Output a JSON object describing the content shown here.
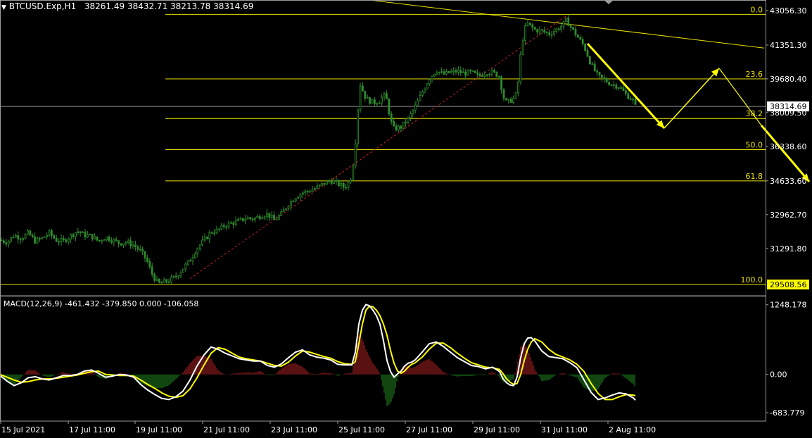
{
  "header": {
    "symbol": "BTCUSD.Exp,H1",
    "ohlc": "38261.49 38432.71 38213.78 38314.69"
  },
  "macd": {
    "label": "MACD(12,26,9) -461.432 -379.850 0.000 -106.058",
    "ticks": [
      "1248.178",
      "0.00",
      "-683.779"
    ]
  },
  "colors": {
    "background": "#000000",
    "bull": "#2E8B2E",
    "bear": "#2E8B2E",
    "fib": "#E8E000",
    "arrow": "#FFFF00",
    "macd_line": "#FFFFFF",
    "signal_line": "#FFFF00",
    "hist_pos": "#B22222",
    "hist_neg": "#228B22"
  },
  "chart_data": {
    "type": "candlestick",
    "symbol": "BTCUSD.Exp",
    "timeframe": "H1",
    "y_ticks": [
      "43056.30",
      "41351.30",
      "39680.40",
      "38009.50",
      "36338.60",
      "34633.60",
      "32962.70",
      "31291.80"
    ],
    "price_labels": {
      "current": "38314.69",
      "low": "29508.56"
    },
    "ylim": [
      29300,
      43300
    ],
    "x_ticks": [
      "15 Jul 2021",
      "17 Jul 11:00",
      "19 Jul 11:00",
      "21 Jul 11:00",
      "23 Jul 11:00",
      "25 Jul 11:00",
      "27 Jul 11:00",
      "29 Jul 11:00",
      "31 Jul 11:00",
      "2 Aug 11:00"
    ],
    "fib_levels": [
      {
        "label": "0.0",
        "price": 42870
      },
      {
        "label": "23.6",
        "price": 39680
      },
      {
        "label": "38.2",
        "price": 37720
      },
      {
        "label": "50.0",
        "price": 36180
      },
      {
        "label": "61.8",
        "price": 34633
      },
      {
        "label": "100.0",
        "price": 29508
      }
    ],
    "price_path": [
      [
        0,
        31700
      ],
      [
        10,
        31600
      ],
      [
        20,
        31950
      ],
      [
        30,
        31800
      ],
      [
        40,
        32050
      ],
      [
        50,
        31650
      ],
      [
        60,
        31800
      ],
      [
        70,
        32050
      ],
      [
        80,
        31700
      ],
      [
        90,
        31650
      ],
      [
        100,
        31900
      ],
      [
        110,
        32150
      ],
      [
        120,
        31950
      ],
      [
        130,
        31900
      ],
      [
        140,
        31650
      ],
      [
        150,
        31850
      ],
      [
        160,
        31700
      ],
      [
        170,
        31550
      ],
      [
        180,
        31600
      ],
      [
        190,
        31450
      ],
      [
        200,
        31150
      ],
      [
        205,
        30900
      ],
      [
        210,
        30600
      ],
      [
        215,
        30100
      ],
      [
        220,
        29800
      ],
      [
        225,
        29550
      ],
      [
        230,
        29600
      ],
      [
        240,
        29700
      ],
      [
        250,
        29900
      ],
      [
        260,
        30300
      ],
      [
        270,
        30700
      ],
      [
        280,
        31300
      ],
      [
        290,
        31700
      ],
      [
        300,
        32100
      ],
      [
        310,
        32200
      ],
      [
        320,
        32450
      ],
      [
        330,
        32550
      ],
      [
        340,
        32650
      ],
      [
        350,
        32800
      ],
      [
        360,
        32750
      ],
      [
        370,
        32900
      ],
      [
        380,
        33000
      ],
      [
        390,
        32700
      ],
      [
        400,
        33000
      ],
      [
        410,
        33500
      ],
      [
        420,
        33850
      ],
      [
        430,
        34050
      ],
      [
        440,
        34150
      ],
      [
        450,
        34300
      ],
      [
        460,
        34500
      ],
      [
        470,
        34650
      ],
      [
        480,
        34500
      ],
      [
        490,
        34300
      ],
      [
        495,
        34550
      ],
      [
        500,
        34900
      ],
      [
        505,
        36500
      ],
      [
        508,
        38000
      ],
      [
        512,
        39400
      ],
      [
        520,
        38700
      ],
      [
        530,
        38500
      ],
      [
        540,
        38600
      ],
      [
        545,
        38900
      ],
      [
        550,
        38600
      ],
      [
        555,
        37600
      ],
      [
        560,
        37200
      ],
      [
        570,
        37300
      ],
      [
        580,
        37700
      ],
      [
        590,
        38300
      ],
      [
        600,
        39000
      ],
      [
        610,
        39700
      ],
      [
        620,
        40100
      ],
      [
        630,
        39900
      ],
      [
        640,
        40000
      ],
      [
        650,
        40050
      ],
      [
        660,
        39950
      ],
      [
        670,
        40000
      ],
      [
        680,
        39800
      ],
      [
        690,
        40000
      ],
      [
        700,
        40000
      ],
      [
        710,
        39800
      ],
      [
        715,
        38800
      ],
      [
        720,
        38500
      ],
      [
        730,
        38700
      ],
      [
        735,
        39000
      ],
      [
        740,
        40900
      ],
      [
        745,
        42100
      ],
      [
        750,
        42400
      ],
      [
        760,
        42100
      ],
      [
        770,
        42050
      ],
      [
        780,
        41900
      ],
      [
        790,
        42100
      ],
      [
        800,
        42350
      ],
      [
        805,
        42600
      ],
      [
        810,
        42300
      ],
      [
        820,
        41800
      ],
      [
        830,
        41300
      ],
      [
        840,
        40400
      ],
      [
        850,
        39800
      ],
      [
        860,
        39600
      ],
      [
        870,
        39400
      ],
      [
        880,
        39300
      ],
      [
        890,
        38900
      ],
      [
        900,
        38600
      ],
      [
        903,
        38314
      ]
    ],
    "macd_line": [
      [
        0,
        -20
      ],
      [
        10,
        -120
      ],
      [
        20,
        -200
      ],
      [
        30,
        -150
      ],
      [
        40,
        -60
      ],
      [
        50,
        -40
      ],
      [
        60,
        -80
      ],
      [
        70,
        -100
      ],
      [
        80,
        -60
      ],
      [
        90,
        -20
      ],
      [
        100,
        -20
      ],
      [
        110,
        0
      ],
      [
        120,
        60
      ],
      [
        130,
        80
      ],
      [
        140,
        20
      ],
      [
        150,
        -50
      ],
      [
        160,
        -30
      ],
      [
        170,
        0
      ],
      [
        180,
        -10
      ],
      [
        190,
        -50
      ],
      [
        200,
        -180
      ],
      [
        210,
        -280
      ],
      [
        220,
        -360
      ],
      [
        230,
        -430
      ],
      [
        240,
        -450
      ],
      [
        250,
        -400
      ],
      [
        260,
        -300
      ],
      [
        270,
        -100
      ],
      [
        280,
        150
      ],
      [
        290,
        350
      ],
      [
        300,
        490
      ],
      [
        310,
        450
      ],
      [
        320,
        380
      ],
      [
        330,
        330
      ],
      [
        340,
        280
      ],
      [
        350,
        260
      ],
      [
        360,
        240
      ],
      [
        370,
        240
      ],
      [
        380,
        160
      ],
      [
        390,
        130
      ],
      [
        400,
        190
      ],
      [
        410,
        300
      ],
      [
        420,
        400
      ],
      [
        430,
        440
      ],
      [
        440,
        350
      ],
      [
        450,
        310
      ],
      [
        460,
        290
      ],
      [
        470,
        260
      ],
      [
        480,
        180
      ],
      [
        490,
        170
      ],
      [
        500,
        170
      ],
      [
        505,
        400
      ],
      [
        510,
        900
      ],
      [
        515,
        1150
      ],
      [
        520,
        1250
      ],
      [
        525,
        1230
      ],
      [
        530,
        1150
      ],
      [
        535,
        1050
      ],
      [
        540,
        900
      ],
      [
        545,
        600
      ],
      [
        550,
        250
      ],
      [
        555,
        50
      ],
      [
        560,
        -50
      ],
      [
        565,
        10
      ],
      [
        570,
        60
      ],
      [
        575,
        150
      ],
      [
        580,
        200
      ],
      [
        585,
        220
      ],
      [
        590,
        260
      ],
      [
        600,
        400
      ],
      [
        610,
        550
      ],
      [
        620,
        580
      ],
      [
        630,
        500
      ],
      [
        640,
        400
      ],
      [
        650,
        300
      ],
      [
        660,
        230
      ],
      [
        670,
        160
      ],
      [
        680,
        140
      ],
      [
        690,
        100
      ],
      [
        700,
        130
      ],
      [
        710,
        50
      ],
      [
        715,
        -80
      ],
      [
        720,
        -150
      ],
      [
        725,
        -190
      ],
      [
        730,
        -200
      ],
      [
        735,
        -40
      ],
      [
        740,
        300
      ],
      [
        745,
        550
      ],
      [
        750,
        650
      ],
      [
        755,
        660
      ],
      [
        760,
        600
      ],
      [
        770,
        420
      ],
      [
        780,
        320
      ],
      [
        790,
        300
      ],
      [
        800,
        280
      ],
      [
        810,
        210
      ],
      [
        820,
        120
      ],
      [
        830,
        -100
      ],
      [
        840,
        -320
      ],
      [
        850,
        -450
      ],
      [
        860,
        -420
      ],
      [
        870,
        -370
      ],
      [
        880,
        -330
      ],
      [
        890,
        -350
      ],
      [
        900,
        -420
      ],
      [
        903,
        -461
      ]
    ],
    "signal_line": [
      [
        0,
        0
      ],
      [
        10,
        -50
      ],
      [
        20,
        -100
      ],
      [
        30,
        -140
      ],
      [
        40,
        -130
      ],
      [
        50,
        -100
      ],
      [
        60,
        -80
      ],
      [
        70,
        -80
      ],
      [
        80,
        -70
      ],
      [
        90,
        -50
      ],
      [
        100,
        -30
      ],
      [
        110,
        -10
      ],
      [
        120,
        20
      ],
      [
        130,
        50
      ],
      [
        140,
        60
      ],
      [
        150,
        0
      ],
      [
        160,
        -10
      ],
      [
        170,
        -20
      ],
      [
        180,
        -20
      ],
      [
        190,
        -30
      ],
      [
        200,
        -100
      ],
      [
        210,
        -180
      ],
      [
        220,
        -250
      ],
      [
        230,
        -330
      ],
      [
        240,
        -390
      ],
      [
        250,
        -410
      ],
      [
        260,
        -380
      ],
      [
        270,
        -260
      ],
      [
        280,
        -60
      ],
      [
        290,
        170
      ],
      [
        300,
        380
      ],
      [
        310,
        480
      ],
      [
        320,
        450
      ],
      [
        330,
        380
      ],
      [
        340,
        310
      ],
      [
        350,
        280
      ],
      [
        360,
        260
      ],
      [
        370,
        240
      ],
      [
        380,
        200
      ],
      [
        390,
        160
      ],
      [
        400,
        150
      ],
      [
        410,
        220
      ],
      [
        420,
        330
      ],
      [
        430,
        420
      ],
      [
        440,
        400
      ],
      [
        450,
        360
      ],
      [
        460,
        320
      ],
      [
        470,
        290
      ],
      [
        480,
        230
      ],
      [
        490,
        190
      ],
      [
        500,
        180
      ],
      [
        505,
        230
      ],
      [
        510,
        550
      ],
      [
        515,
        900
      ],
      [
        520,
        1150
      ],
      [
        525,
        1220
      ],
      [
        530,
        1210
      ],
      [
        535,
        1150
      ],
      [
        540,
        1050
      ],
      [
        545,
        900
      ],
      [
        550,
        700
      ],
      [
        555,
        430
      ],
      [
        560,
        200
      ],
      [
        565,
        60
      ],
      [
        570,
        20
      ],
      [
        575,
        60
      ],
      [
        580,
        130
      ],
      [
        585,
        180
      ],
      [
        590,
        210
      ],
      [
        600,
        310
      ],
      [
        610,
        450
      ],
      [
        620,
        560
      ],
      [
        630,
        560
      ],
      [
        640,
        480
      ],
      [
        650,
        380
      ],
      [
        660,
        290
      ],
      [
        670,
        210
      ],
      [
        680,
        170
      ],
      [
        690,
        130
      ],
      [
        700,
        120
      ],
      [
        710,
        90
      ],
      [
        715,
        10
      ],
      [
        720,
        -80
      ],
      [
        725,
        -140
      ],
      [
        730,
        -180
      ],
      [
        735,
        -160
      ],
      [
        740,
        0
      ],
      [
        745,
        250
      ],
      [
        750,
        450
      ],
      [
        755,
        580
      ],
      [
        760,
        640
      ],
      [
        770,
        580
      ],
      [
        780,
        450
      ],
      [
        790,
        360
      ],
      [
        800,
        310
      ],
      [
        810,
        260
      ],
      [
        820,
        180
      ],
      [
        830,
        50
      ],
      [
        840,
        -160
      ],
      [
        850,
        -340
      ],
      [
        860,
        -450
      ],
      [
        870,
        -450
      ],
      [
        880,
        -400
      ],
      [
        890,
        -360
      ],
      [
        900,
        -370
      ],
      [
        903,
        -380
      ]
    ],
    "forecast_label": "projected path (arrows)",
    "forecast": []
  }
}
